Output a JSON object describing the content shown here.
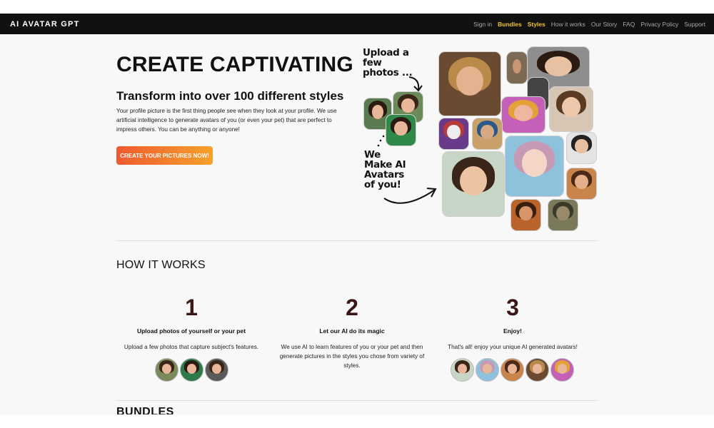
{
  "nav": {
    "brand": "AI AVATAR GPT",
    "links": [
      "Sign in",
      "Bundles",
      "Styles",
      "How it works",
      "Our Story",
      "FAQ",
      "Privacy Policy",
      "Support"
    ]
  },
  "hero": {
    "title": "CREATE CAPTIVATING",
    "subtitle": "Transform into over 100 different styles",
    "description": "Your profile picture is the first thing people see when they look at your profile. We use artificial intelligence to generate avatars of you (or even your pet) that are perfect to impress others. You can be anything or anyone!",
    "cta": "CREATE YOUR PICTURES NOW!",
    "handwritten_top": "Upload a few photos ...",
    "handwritten_bottom": "We Make AI Avatars of you!"
  },
  "how_it_works": {
    "title": "HOW IT WORKS",
    "steps": [
      {
        "number": "1",
        "title": "Upload photos of yourself or your pet",
        "description": "Upload a few photos that capture subject's features."
      },
      {
        "number": "2",
        "title": "Let our AI do its magic",
        "description": "We use AI to learn features of you or your pet and then generate pictures in the styles you chose from variety of styles."
      },
      {
        "number": "3",
        "title": "Enjoy!",
        "description": "That's all! enjoy your unique AI generated avatars!"
      }
    ]
  },
  "bundles": {
    "title": "BUNDLES"
  },
  "colors": {
    "accent": "#f2c12e",
    "cta_start": "#ef5a2f",
    "cta_end": "#f6a12c",
    "step_number": "#3a1616"
  }
}
